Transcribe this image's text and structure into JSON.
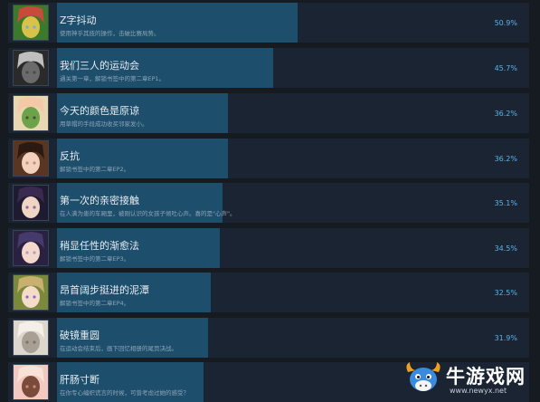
{
  "achievements": [
    {
      "title": "Z字抖动",
      "desc": "使用神乎其技的操作，击破比赛局势。",
      "pct": "50.9%",
      "fill": 0.509,
      "thumb": {
        "name": "thumb-z-shake-icon",
        "colors": [
          "#3a7a2a",
          "#d8c24a",
          "#c94a3a",
          "#6fb0d8"
        ]
      }
    },
    {
      "title": "我们三人的运动会",
      "desc": "通关第一章，解锁书签中的第二章EP1。",
      "pct": "45.7%",
      "fill": 0.457,
      "thumb": {
        "name": "thumb-sports-day-icon",
        "colors": [
          "#2a2a2a",
          "#6b6b6b",
          "#bfbfbf",
          "#4a4a4a"
        ]
      }
    },
    {
      "title": "今天的颜色是原谅",
      "desc": "用草帽的手段成功收买邻家发小。",
      "pct": "36.2%",
      "fill": 0.362,
      "thumb": {
        "name": "thumb-forgiveness-color-icon",
        "colors": [
          "#e8d7b0",
          "#6ea24a",
          "#f4c9a8",
          "#3f5a2a"
        ]
      }
    },
    {
      "title": "反抗",
      "desc": "解锁书签中的第二章EP2。",
      "pct": "36.2%",
      "fill": 0.362,
      "thumb": {
        "name": "thumb-resist-icon",
        "colors": [
          "#5a3520",
          "#f2d2bf",
          "#2a1a12",
          "#c89070"
        ]
      }
    },
    {
      "title": "第一次的亲密接触",
      "desc": "在人满为患的车厢里，被刚认识的女孩子倾吐心声。喜的是\"心声\"。",
      "pct": "35.1%",
      "fill": 0.351,
      "thumb": {
        "name": "thumb-first-contact-icon",
        "colors": [
          "#1e1a30",
          "#f0d4c4",
          "#3a2a50",
          "#8a6a9a"
        ]
      }
    },
    {
      "title": "稍显任性的渐愈法",
      "desc": "解锁书签中的第二章EP3。",
      "pct": "34.5%",
      "fill": 0.345,
      "thumb": {
        "name": "thumb-healing-method-icon",
        "colors": [
          "#2a2040",
          "#f4d8cc",
          "#463a6a",
          "#b09ac8"
        ]
      }
    },
    {
      "title": "昂首阔步挺进的泥潭",
      "desc": "解锁书签中的第二章EP4。",
      "pct": "32.5%",
      "fill": 0.325,
      "thumb": {
        "name": "thumb-mire-icon",
        "colors": [
          "#7a8a3a",
          "#f4dcc8",
          "#c8b070",
          "#8a6acf"
        ]
      }
    },
    {
      "title": "破镜重圆",
      "desc": "在运动会结束后，画下回忆相册的尾页决战。",
      "pct": "31.9%",
      "fill": 0.319,
      "thumb": {
        "name": "thumb-reunion-icon",
        "colors": [
          "#dcd6cc",
          "#a8a094",
          "#f4efe8",
          "#7c746a"
        ]
      }
    },
    {
      "title": "肝肠寸断",
      "desc": "在你专心编织谎言的时候，可曾考虑过她的感受？",
      "pct": "",
      "fill": 0.31,
      "thumb": {
        "name": "thumb-heartbreak-icon",
        "colors": [
          "#f2c8c0",
          "#7a4a3a",
          "#f8e2d8",
          "#c98a7a"
        ]
      }
    }
  ],
  "watermark": {
    "text": "牛游戏网",
    "url": "www.newyx.net",
    "colors": {
      "horns": "#f0a020",
      "face": "#3a8ae0"
    }
  }
}
